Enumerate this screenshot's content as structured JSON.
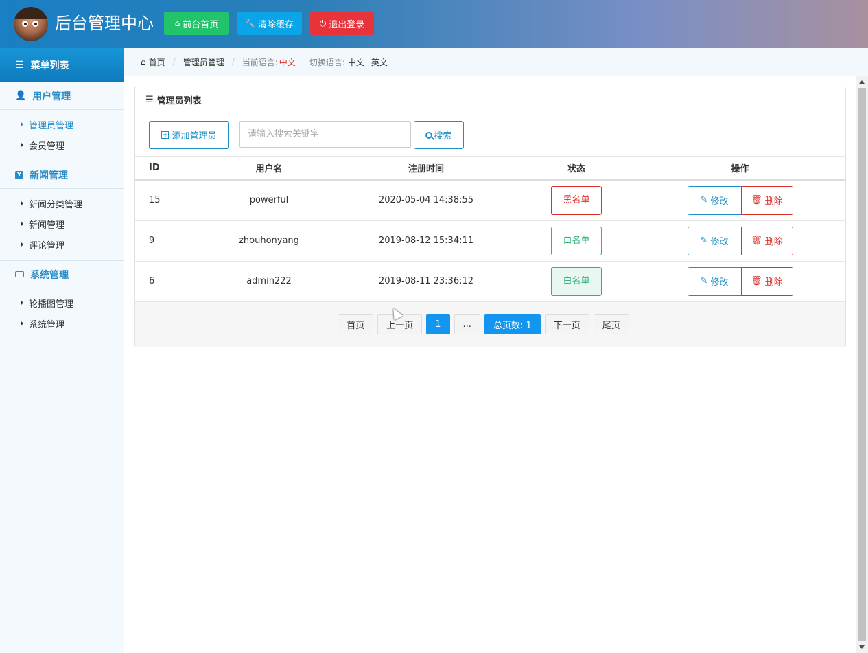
{
  "header": {
    "title": "后台管理中心",
    "buttons": [
      {
        "label": "前台首页",
        "icon": "home-icon",
        "color": "#23c36b"
      },
      {
        "label": "清除缓存",
        "icon": "wrench-icon",
        "color": "#0aa4e8"
      },
      {
        "label": "退出登录",
        "icon": "power-icon",
        "color": "#e8333a"
      }
    ]
  },
  "sidebar": {
    "title": "菜单列表",
    "groups": [
      {
        "label": "用户管理",
        "icon": "user-icon",
        "items": [
          "管理员管理",
          "会员管理"
        ]
      },
      {
        "label": "新闻管理",
        "icon": "y-icon",
        "items": [
          "新闻分类管理",
          "新闻管理",
          "评论管理"
        ]
      },
      {
        "label": "系统管理",
        "icon": "drive-icon",
        "items": [
          "轮播图管理",
          "系统管理"
        ]
      }
    ],
    "active_item": "管理员管理"
  },
  "breadcrumb": {
    "home": "首页",
    "current": "管理员管理",
    "lang_label": "当前语言:",
    "lang_value": "中文",
    "switch_label": "切换语言:",
    "switch_zh": "中文",
    "switch_en": "英文"
  },
  "panel": {
    "title": "管理员列表",
    "add_button": "添加管理员",
    "search_placeholder": "请输入搜索关键字",
    "search_button": "搜索",
    "columns": [
      "ID",
      "用户名",
      "注册时间",
      "状态",
      "操作"
    ],
    "rows": [
      {
        "id": "15",
        "username": "powerful",
        "time": "2020-05-04 14:38:55",
        "status": "黑名单"
      },
      {
        "id": "9",
        "username": "zhouhonyang",
        "time": "2019-08-12 15:34:11",
        "status": "白名单"
      },
      {
        "id": "6",
        "username": "admin222",
        "time": "2019-08-11 23:36:12",
        "status": "白名单"
      }
    ],
    "edit_label": "修改",
    "delete_label": "删除"
  },
  "pager": {
    "first": "首页",
    "prev": "上一页",
    "current": "1",
    "ellipsis": "...",
    "total": "总页数: 1",
    "next": "下一页",
    "last": "尾页"
  },
  "colors": {
    "accent": "#1b8ec7",
    "danger": "#d9302a",
    "success": "#2eb57a",
    "pager_blue": "#1296ef"
  }
}
